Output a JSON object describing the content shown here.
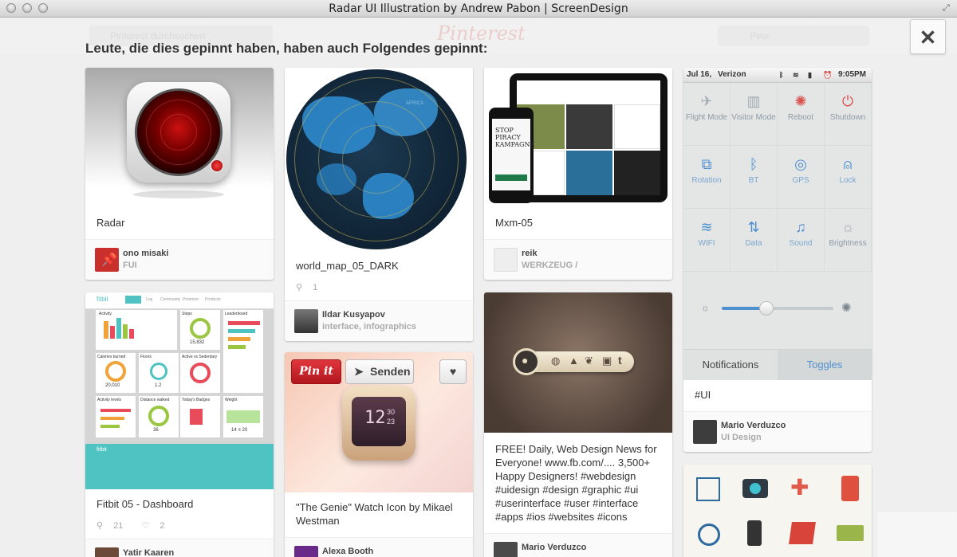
{
  "window": {
    "title": "Radar UI Illustration by Andrew Pabon | ScreenDesign"
  },
  "background": {
    "search_text": "Pinterest durchsuchen",
    "logo": "Pinterest",
    "user_name": "Pete"
  },
  "heading": "Leute, die dies gepinnt haben, haben auch Folgendes gepinnt:",
  "close_label": "✕",
  "pins": {
    "radar": {
      "description": "Radar",
      "user": "ono misaki",
      "board": "FUI"
    },
    "fitbit": {
      "description": "Fitbit 05 - Dashboard",
      "repins": "21",
      "likes": "2",
      "user": "Yatir Kaaren",
      "shot": {
        "logo": "fitbit",
        "nav": [
          "Dashboard",
          "Log",
          "Community",
          "Premium",
          "Products"
        ],
        "tiles": [
          "Activity",
          "Steps",
          "Leaderboard",
          "Calories burned",
          "Floors",
          "Active vs Sedentary",
          "Activity levels",
          "Distance walked",
          "Today's Badges",
          "Weight"
        ],
        "values": [
          "15,832",
          "20,010",
          "1.2",
          "36",
          "14 ≡ 20"
        ]
      }
    },
    "world": {
      "description": "world_map_05_DARK",
      "repins": "1",
      "user": "Ildar Kusyapov",
      "board": "interface, infographics",
      "map_label": "AFRICA"
    },
    "genie": {
      "description": "\"The Genie\" Watch Icon by Mikael Westman",
      "user": "Alexa Booth",
      "pinit": "Pin it",
      "senden": "Senden",
      "watch_time": [
        "12",
        "30",
        "23"
      ]
    },
    "mxm": {
      "description": "Mxm-05",
      "user": "reik",
      "board": "WERKZEUG /",
      "phone_text": "STOP PIRACY KAMPAGNE"
    },
    "free": {
      "description": "FREE! Daily, Web Design News for Everyone! www.fb.com/.... 3,500+ Happy Designers! #webdesign #uidesign #design #graphic #ui #userinterface #user #interface #apps #ios #websites #icons",
      "user": "Mario Verduzco"
    },
    "toggles": {
      "status": {
        "date": "Jul 16,",
        "carrier": "Verizon",
        "time": "9:05PM"
      },
      "cells": [
        {
          "label": "Flight Mode",
          "icon": "airplane-icon",
          "glyph": "✈",
          "tone": "grey"
        },
        {
          "label": "Visitor Mode",
          "icon": "visitor-icon",
          "glyph": "▥",
          "tone": "grey"
        },
        {
          "label": "Reboot",
          "icon": "reboot-icon",
          "glyph": "✺",
          "tone": "red"
        },
        {
          "label": "Shutdown",
          "icon": "power-icon",
          "glyph": "⏻",
          "tone": "red"
        },
        {
          "label": "Rotation",
          "icon": "rotation-icon",
          "glyph": "⧉",
          "tone": "blue"
        },
        {
          "label": "BT",
          "icon": "bluetooth-icon",
          "glyph": "ᛒ",
          "tone": "blue"
        },
        {
          "label": "GPS",
          "icon": "gps-icon",
          "glyph": "◎",
          "tone": "blue"
        },
        {
          "label": "Lock",
          "icon": "lock-icon",
          "glyph": "⍝",
          "tone": "blue"
        },
        {
          "label": "WIFI",
          "icon": "wifi-icon",
          "glyph": "≋",
          "tone": "blue"
        },
        {
          "label": "Data",
          "icon": "data-icon",
          "glyph": "⇅",
          "tone": "blue"
        },
        {
          "label": "Sound",
          "icon": "bell-icon",
          "glyph": "♫",
          "tone": "blue"
        },
        {
          "label": "Brightness",
          "icon": "brightness-icon",
          "glyph": "☼",
          "tone": "grey"
        }
      ],
      "brightness_level": 0.4,
      "tab_notifications": "Notifications",
      "tab_toggles": "Toggles",
      "description": "#UI",
      "user": "Mario Verduzco",
      "board": "UI Design"
    }
  },
  "colors": {
    "pinit_red": "#cb2027",
    "teal": "#4fc3c1",
    "toggle_blue": "#4f90cf"
  }
}
